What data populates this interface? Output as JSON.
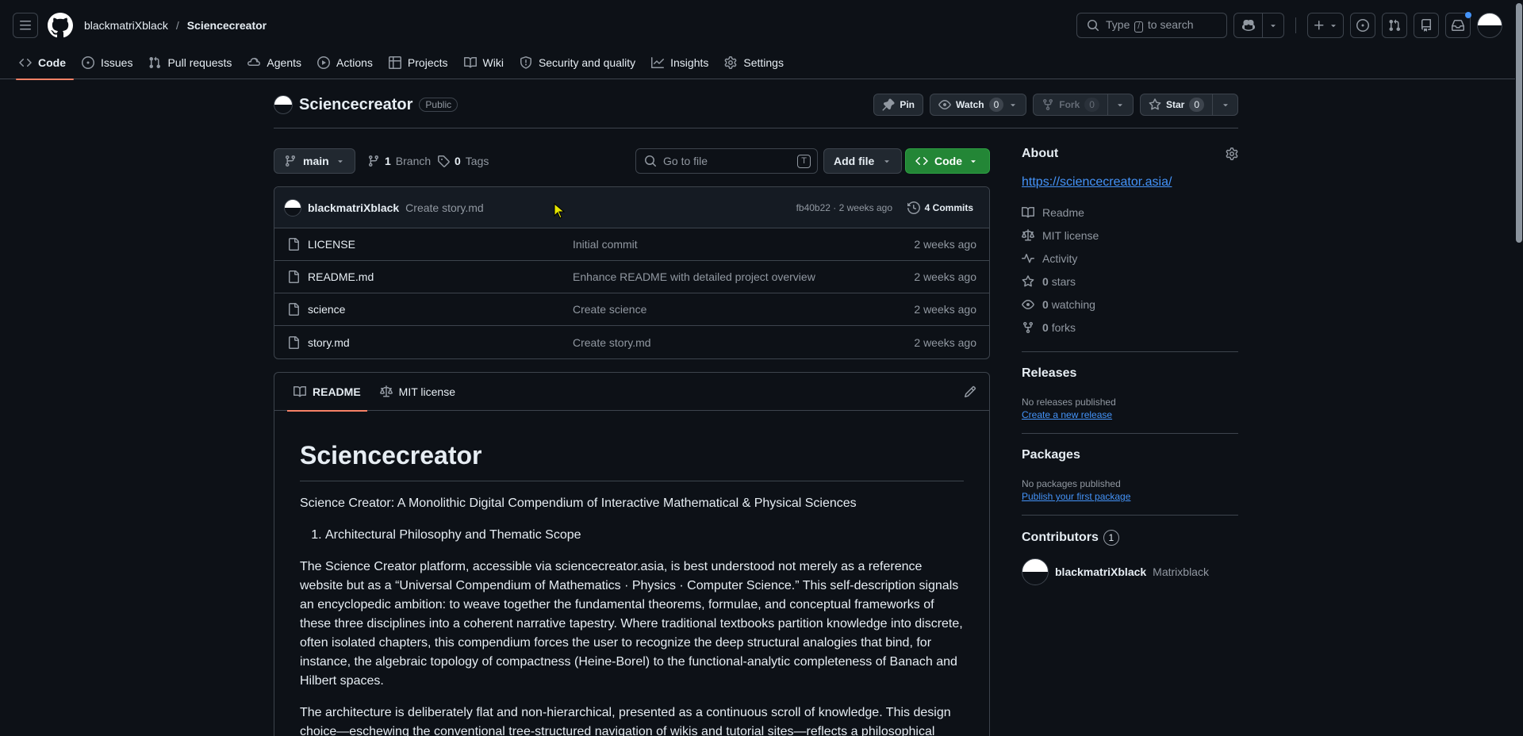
{
  "header": {
    "owner": "blackmatriXblack",
    "separator": "/",
    "repo": "Sciencecreator",
    "search_prefix": "Type",
    "search_key": "/",
    "search_suffix": "to search"
  },
  "repo_nav": [
    {
      "label": "Code",
      "icon": "code-icon"
    },
    {
      "label": "Issues",
      "icon": "issue-icon"
    },
    {
      "label": "Pull requests",
      "icon": "pull-request-icon"
    },
    {
      "label": "Agents",
      "icon": "agent-icon"
    },
    {
      "label": "Actions",
      "icon": "play-icon"
    },
    {
      "label": "Projects",
      "icon": "table-icon"
    },
    {
      "label": "Wiki",
      "icon": "book-icon"
    },
    {
      "label": "Security and quality",
      "icon": "shield-icon"
    },
    {
      "label": "Insights",
      "icon": "graph-icon"
    },
    {
      "label": "Settings",
      "icon": "gear-icon"
    }
  ],
  "repo": {
    "name": "Sciencecreator",
    "visibility": "Public",
    "pin_label": "Pin",
    "watch_label": "Watch",
    "watch_count": "0",
    "fork_label": "Fork",
    "fork_count": "0",
    "star_label": "Star",
    "star_count": "0"
  },
  "toolbar": {
    "branch": "main",
    "branches_count": "1",
    "branches_label": "Branch",
    "tags_count": "0",
    "tags_label": "Tags",
    "goto_placeholder": "Go to file",
    "goto_key": "T",
    "add_file": "Add file",
    "code": "Code"
  },
  "commit": {
    "author": "blackmatriXblack",
    "message": "Create story.md",
    "meta": "fb40b22 · 2 weeks ago",
    "commits_label": "4 Commits"
  },
  "files": [
    {
      "name": "LICENSE",
      "message": "Initial commit",
      "time": "2 weeks ago"
    },
    {
      "name": "README.md",
      "message": "Enhance README with detailed project overview",
      "time": "2 weeks ago"
    },
    {
      "name": "science",
      "message": "Create science",
      "time": "2 weeks ago"
    },
    {
      "name": "story.md",
      "message": "Create story.md",
      "time": "2 weeks ago"
    }
  ],
  "readme": {
    "tab_readme": "README",
    "tab_license": "MIT license",
    "title": "Sciencecreator",
    "intro": "Science Creator: A Monolithic Digital Compendium of Interactive Mathematical & Physical Sciences",
    "list_item": "Architectural Philosophy and Thematic Scope",
    "para1": "The Science Creator platform, accessible via sciencecreator.asia, is best understood not merely as a reference website but as a “Universal Compendium of Mathematics · Physics · Computer Science.” This self-description signals an encyclopedic ambition: to weave together the fundamental theorems, formulae, and conceptual frameworks of these three disciplines into a coherent narrative tapestry. Where traditional textbooks partition knowledge into discrete, often isolated chapters, this compendium forces the user to recognize the deep structural analogies that bind, for instance, the algebraic topology of compactness (Heine-Borel) to the functional-analytic completeness of Banach and Hilbert spaces.",
    "para2": "The architecture is deliberately flat and non-hierarchical, presented as a continuous scroll of knowledge. This design choice—eschewing the conventional tree-structured navigation of wikis and tutorial sites—reflects a philosophical"
  },
  "about": {
    "title": "About",
    "link": "https://sciencecreator.asia/",
    "items": [
      {
        "icon": "book-icon",
        "label": "Readme",
        "count": ""
      },
      {
        "icon": "law-icon",
        "label": "MIT license",
        "count": ""
      },
      {
        "icon": "pulse-icon",
        "label": "Activity",
        "count": ""
      },
      {
        "icon": "star-icon",
        "label": "stars",
        "count": "0"
      },
      {
        "icon": "eye-icon",
        "label": "watching",
        "count": "0"
      },
      {
        "icon": "fork-icon",
        "label": "forks",
        "count": "0"
      }
    ]
  },
  "releases": {
    "title": "Releases",
    "none": "No releases published",
    "link": "Create a new release"
  },
  "packages": {
    "title": "Packages",
    "none": "No packages published",
    "link": "Publish your first package"
  },
  "contributors": {
    "title": "Contributors",
    "count": "1",
    "login": "blackmatriXblack",
    "fullname": "Matrixblack"
  }
}
